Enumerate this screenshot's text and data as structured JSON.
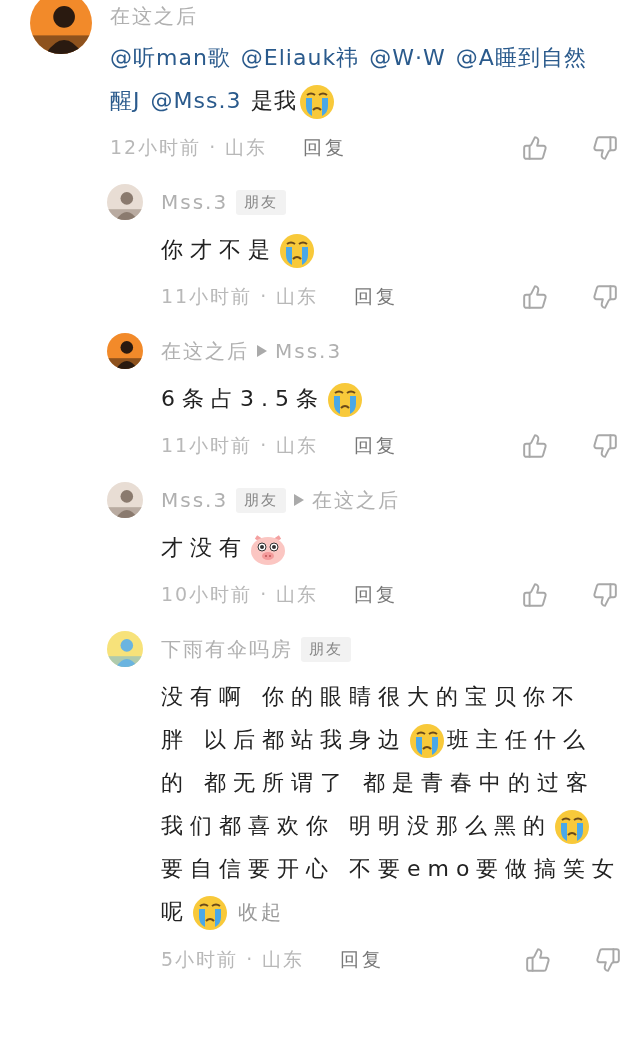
{
  "comments": [
    {
      "author": "在这之后",
      "avatar": {
        "kind": "picture"
      },
      "content": [
        [
          {
            "kind": "mention",
            "text": "@听man歌"
          },
          {
            "kind": "mention",
            "text": "@Eliauk祎"
          },
          {
            "kind": "mention",
            "text": "@W·W"
          },
          {
            "kind": "mention",
            "text": "@A睡到自然"
          }
        ],
        [
          {
            "kind": "mention",
            "text": "醒J"
          },
          {
            "kind": "mention",
            "text": "@Mss.3"
          },
          {
            "kind": "text",
            "text": "是我"
          },
          {
            "kind": "cry"
          }
        ]
      ],
      "time": "12小时前 · 山东",
      "reply": "回复",
      "replies": [
        {
          "author": "Mss.3",
          "badge": "朋友",
          "avatar": {
            "kind": "picture"
          },
          "content": [
            [
              {
                "kind": "text",
                "text": "你才不是"
              },
              {
                "kind": "cry"
              }
            ]
          ],
          "time": "11小时前 · 山东",
          "reply": "回复"
        },
        {
          "author": "在这之后",
          "reply_to": "Mss.3",
          "avatar": {
            "kind": "picture"
          },
          "content": [
            [
              {
                "kind": "text",
                "text": "6条占3.5条"
              },
              {
                "kind": "cry"
              }
            ]
          ],
          "time": "11小时前 · 山东",
          "reply": "回复"
        },
        {
          "author": "Mss.3",
          "badge": "朋友",
          "reply_to": "在这之后",
          "avatar": {
            "kind": "picture"
          },
          "content": [
            [
              {
                "kind": "text",
                "text": "才没有"
              },
              {
                "kind": "pig"
              }
            ]
          ],
          "time": "10小时前 · 山东",
          "reply": "回复"
        },
        {
          "author": "下雨有伞吗房",
          "badge": "朋友",
          "avatar": {
            "kind": "picture"
          },
          "content": [
            [
              {
                "kind": "text",
                "text": "没有啊 你的眼睛很大的宝贝你不"
              }
            ],
            [
              {
                "kind": "text",
                "text": "胖 以后都站我身边"
              },
              {
                "kind": "cry"
              },
              {
                "kind": "text",
                "text": "班主任什么"
              }
            ],
            [
              {
                "kind": "text",
                "text": "的 都无所谓了 都是青春中的过客"
              }
            ],
            [
              {
                "kind": "text",
                "text": "我们都喜欢你 明明没那么黑的"
              },
              {
                "kind": "cry"
              }
            ],
            [
              {
                "kind": "text",
                "text": "要自信要开心 不要emo要做搞笑女"
              }
            ],
            [
              {
                "kind": "text",
                "text": "呢"
              },
              {
                "kind": "cry"
              },
              {
                "kind": "link",
                "text": "收起"
              }
            ]
          ],
          "time": "5小时前 · 山东",
          "reply": "回复"
        }
      ]
    }
  ]
}
